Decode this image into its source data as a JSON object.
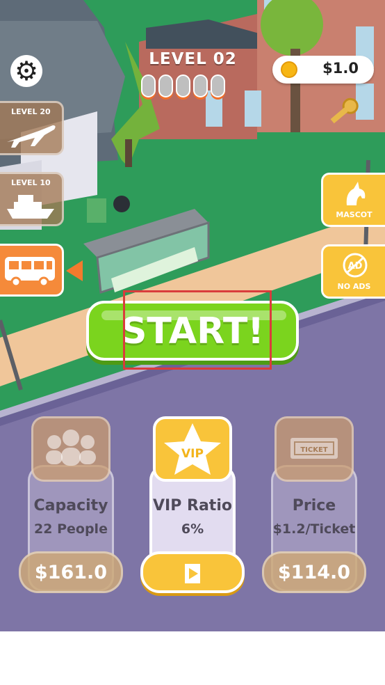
{
  "hud": {
    "level": "LEVEL 02",
    "coins": "$1.0",
    "progress_pips": 5
  },
  "side_left": {
    "plane": "LEVEL 20",
    "ship": "LEVEL 10"
  },
  "side_right": {
    "mascot": "MASCOT",
    "no_ads": "NO ADS",
    "ad_badge": "AD"
  },
  "start_label": "START!",
  "upgrades": [
    {
      "title": "Capacity",
      "value": "22 People",
      "price": "$161.0"
    },
    {
      "title": "VIP Ratio",
      "value": "6%",
      "badge": "VIP"
    },
    {
      "title": "Price",
      "value": "$1.2/Ticket",
      "price": "$114.0",
      "ticket": "TICKET"
    }
  ],
  "colors": {
    "start_green": "#7bd41e",
    "accent_orange": "#f37a2d",
    "gold": "#f9c43a",
    "road_purple": "#7e75a6",
    "grass_green": "#2e9c5a"
  }
}
